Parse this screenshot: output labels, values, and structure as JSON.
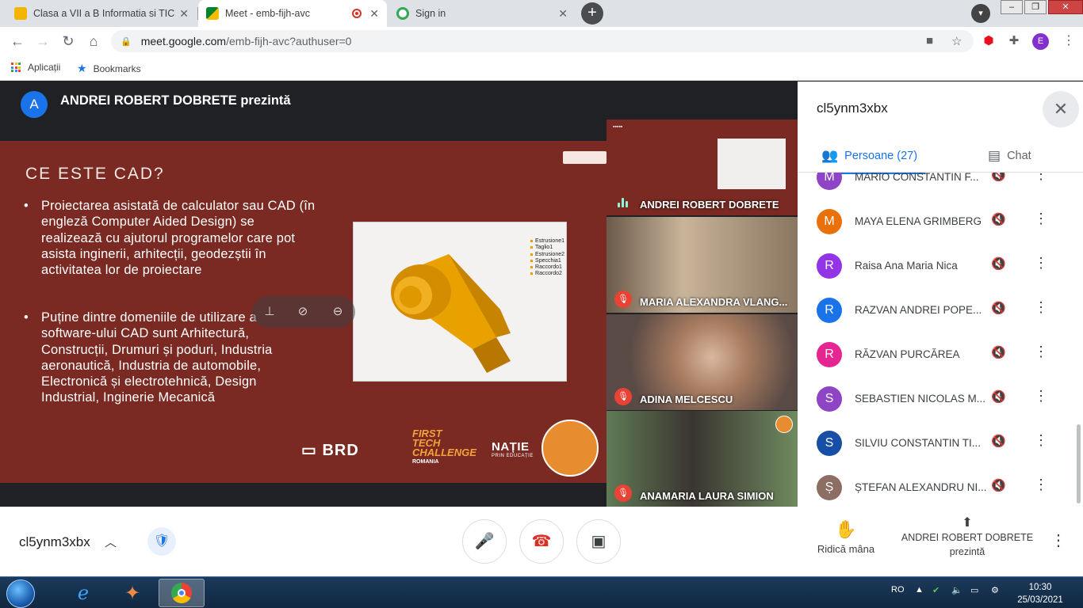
{
  "browser": {
    "tabs": [
      {
        "title": "Clasa a VII a B Informatia si TIC",
        "icon": "classroom-icon",
        "color": "#f4b400"
      },
      {
        "title": "Meet - emb-fijh-avc",
        "icon": "meet-icon",
        "color": "#00832d"
      },
      {
        "title": "Sign in",
        "icon": "signin-icon",
        "color": "#34a853"
      }
    ],
    "url_host": "meet.google.com",
    "url_path": "/emb-fijh-avc?authuser=0",
    "profile_initial": "E",
    "bookmarks": [
      {
        "label": "Aplicații",
        "icon": "apps-grid-icon"
      },
      {
        "label": "Bookmarks",
        "icon": "star-icon"
      }
    ]
  },
  "meet": {
    "presenter_initial": "A",
    "presenter_text": "ANDREI ROBERT DOBRETE prezintă",
    "slide": {
      "title": "CE ESTE CAD?",
      "bullets": [
        "Proiectarea asistată de calculator sau CAD (în engleză Computer Aided Design) se realizează cu ajutorul programelor care pot asista inginerii, arhitecții, geodezștii în activitatea lor de proiectare",
        "Puține dintre domeniile de utilizare a software-ului CAD sunt  Arhitectură, Construcții, Drumuri și poduri, Industria aeronautică, Industria de automobile, Electronică și electrotehnică, Design Industrial, Inginerie Mecanică"
      ],
      "legend": [
        "Estrusione1",
        "Taglio1",
        "Estrusione2",
        "Specchia1",
        "Raccordo1",
        "Raccordo2"
      ],
      "logos": {
        "brd": "BRD",
        "ftc_first": "FIRST",
        "ftc_tech": "TECH",
        "ftc_challenge": "CHALLENGE",
        "ftc_country": "ROMANIA",
        "natie": "NAȚIE",
        "natie_sub": "PRIN EDUCAȚIE"
      }
    },
    "tiles": [
      {
        "name": "ANDREI ROBERT DOBRETE",
        "speaking": true
      },
      {
        "name": "MARIA ALEXANDRA VLANG...",
        "muted": true
      },
      {
        "name": "ADINA MELCESCU",
        "muted": true
      },
      {
        "name": "ANAMARIA LAURA SIMION",
        "muted": true
      }
    ],
    "meeting_code": "cl5ynm3xbx",
    "raise_hand": "Ridică mâna",
    "presenting_line1": "ANDREI ROBERT DOBRETE",
    "presenting_line2": "prezintă"
  },
  "panel": {
    "title": "cl5ynm3xbx",
    "tab_people": "Persoane (27)",
    "tab_chat": "Chat",
    "people": [
      {
        "initial": "M",
        "name": "MARIO CONSTANTIN F...",
        "color": "#8e44c4"
      },
      {
        "initial": "M",
        "name": "MAYA ELENA GRIMBERG",
        "color": "#e8710a"
      },
      {
        "initial": "R",
        "name": "Raisa Ana Maria Nica",
        "color": "#9334e6"
      },
      {
        "initial": "R",
        "name": "RAZVAN ANDREI POPE...",
        "color": "#1a73e8"
      },
      {
        "initial": "R",
        "name": "RĂZVAN PURCĂREA",
        "color": "#e52592"
      },
      {
        "initial": "S",
        "name": "SEBASTIEN NICOLAS M...",
        "color": "#8e44c4"
      },
      {
        "initial": "S",
        "name": "SILVIU CONSTANTIN TI...",
        "color": "#174ea6"
      },
      {
        "initial": "Ș",
        "name": "ȘTEFAN ALEXANDRU NI...",
        "color": "#8d6e63"
      }
    ]
  },
  "taskbar": {
    "lang": "RO",
    "time": "10:30",
    "date": "25/03/2021"
  }
}
